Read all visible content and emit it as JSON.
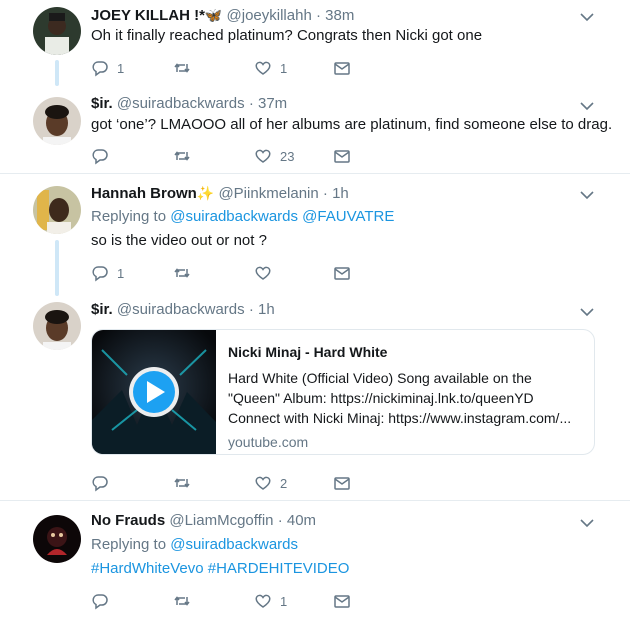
{
  "tweets": [
    {
      "name": "JOEY KILLAH !*",
      "emoji": "🦋",
      "handle": "@joeykillahh",
      "time": "38m",
      "text": "Oh it finally reached platinum? Congrats then Nicki got one",
      "replies": "1",
      "retweets": "",
      "likes": "1"
    },
    {
      "name": "$ir.",
      "handle": "@suiradbackwards",
      "time": "37m",
      "text": "got ‘one’? LMAOOO all of her albums are platinum, find someone else to drag.",
      "replies": "",
      "retweets": "",
      "likes": "23"
    },
    {
      "name": "Hannah Brown",
      "emoji": "✨",
      "handle": "@Piinkmelanin",
      "time": "1h",
      "replying_label": "Replying to",
      "replying_to": "@suiradbackwards @FAUVATRE",
      "text": "so is the video out or not ?",
      "replies": "1",
      "retweets": "",
      "likes": ""
    },
    {
      "name": "$ir.",
      "handle": "@suiradbackwards",
      "time": "1h",
      "card": {
        "title": "Nicki Minaj - Hard White",
        "desc_1": "Hard White (Official Video) Song available on the",
        "desc_2": "\"Queen\" Album: https://nickiminaj.lnk.to/queenYD",
        "desc_3": "Connect with Nicki Minaj: https://www.instagram.com/...",
        "domain": "youtube.com"
      },
      "replies": "",
      "retweets": "",
      "likes": "2"
    },
    {
      "name": "No Frauds",
      "handle": "@LiamMcgoffin",
      "time": "40m",
      "replying_label": "Replying to",
      "replying_to": "@suiradbackwards",
      "text": "#HardWhiteVevo #HARDEHITEVIDEO",
      "replies": "",
      "retweets": "",
      "likes": "1"
    }
  ],
  "separator_dot": "·",
  "colors": {
    "link": "#1b95e0",
    "muted": "#657786",
    "thread": "#cfe7f7"
  },
  "icons": [
    "avatar",
    "reply-icon",
    "retweet-icon",
    "like-icon",
    "dm-icon",
    "chevron-down-icon",
    "play-icon"
  ]
}
